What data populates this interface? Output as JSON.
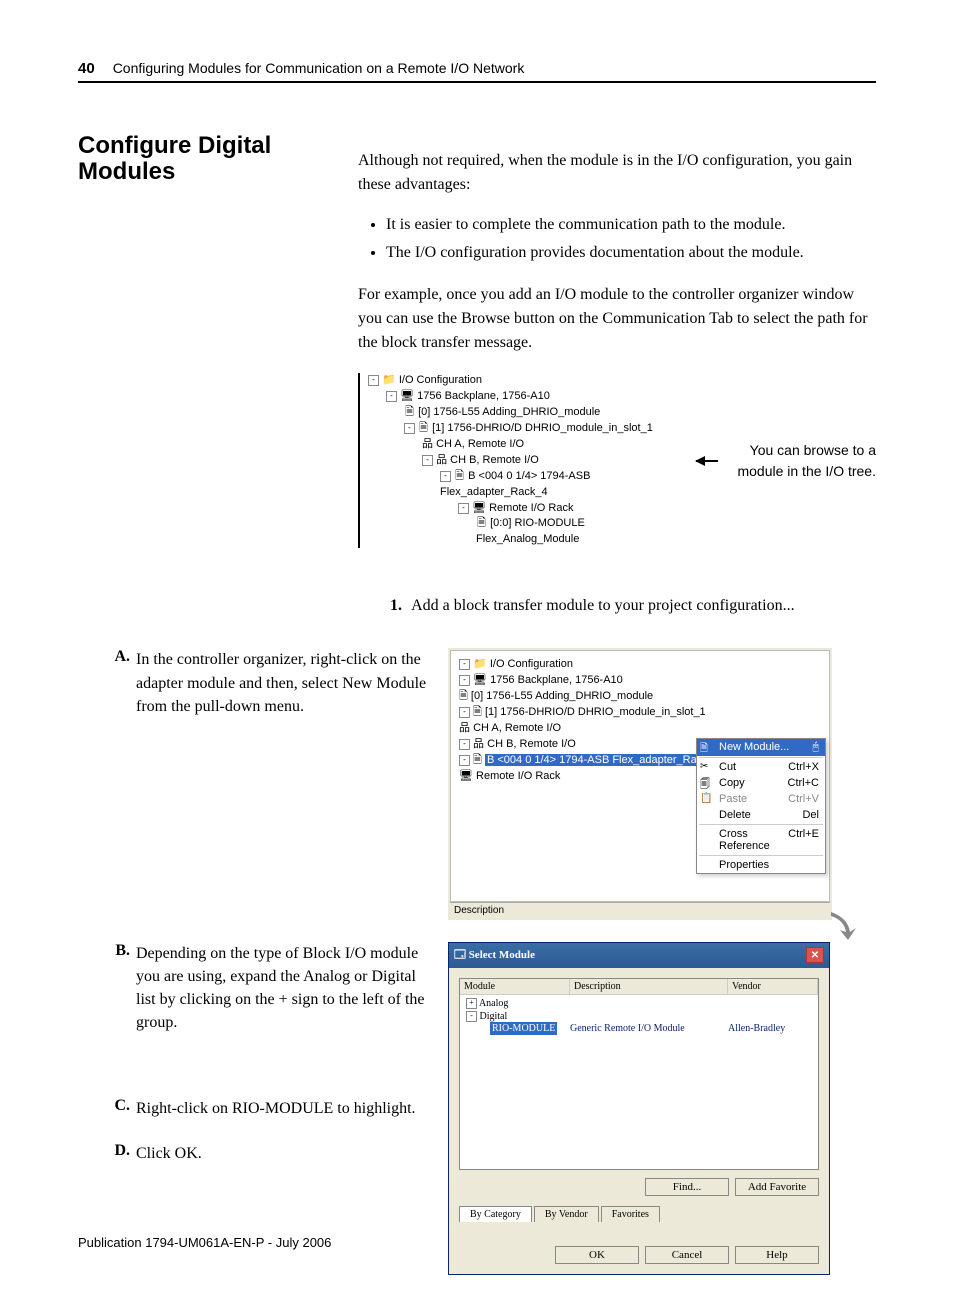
{
  "page": {
    "number": "40",
    "header": "Configuring Modules for Communication on a Remote I/O Network",
    "footer": "Publication 1794-UM061A-EN-P - July 2006"
  },
  "section": {
    "heading": "Configure Digital Modules",
    "intro": "Although not required, when the module is in the I/O configuration, you gain these advantages:",
    "bullets": [
      "It is easier to complete the communication path to the module.",
      "The I/O configuration provides documentation about the module."
    ],
    "example": "For example, once you add an I/O module to the controller organizer window you can use the Browse button on the Communication Tab to select the path for the block transfer message."
  },
  "tree1": {
    "l0": "I/O Configuration",
    "l1": "1756 Backplane, 1756-A10",
    "l2a": "[0] 1756-L55 Adding_DHRIO_module",
    "l2b": "[1] 1756-DHRIO/D DHRIO_module_in_slot_1",
    "l3a": "CH A, Remote I/O",
    "l3b": "CH B, Remote I/O",
    "l4": "B <004 0 1/4> 1794-ASB Flex_adapter_Rack_4",
    "l5": "Remote I/O Rack",
    "l6": "[0:0] RIO-MODULE Flex_Analog_Module"
  },
  "callout": "You can browse to a module in the I/O tree.",
  "step1": {
    "num": "1.",
    "text": "Add a block transfer module to your project configuration..."
  },
  "substeps": {
    "A": {
      "letter": "A.",
      "text": "In the controller organizer, right-click on the adapter module and then, select New Module from the pull-down menu."
    },
    "B": {
      "letter": "B.",
      "text": "Depending on the type of Block I/O module you are using, expand the Analog or Digital list by clicking on the + sign to the left of the group."
    },
    "C": {
      "letter": "C.",
      "text": "Right-click on RIO-MODULE to highlight."
    },
    "D": {
      "letter": "D.",
      "text": "Click OK."
    }
  },
  "ssA": {
    "tree": {
      "l0": "I/O Configuration",
      "l1": "1756 Backplane, 1756-A10",
      "l2a": "[0] 1756-L55 Adding_DHRIO_module",
      "l2b": "[1] 1756-DHRIO/D DHRIO_module_in_slot_1",
      "l3a": "CH A, Remote I/O",
      "l3b": "CH B, Remote I/O",
      "l4": "B <004 0 1/4> 1794-ASB Flex_adapter_Rack_4",
      "l5": "Remote I/O Rack"
    },
    "menu": {
      "new": "New Module...",
      "cut": "Cut",
      "cut_k": "Ctrl+X",
      "copy": "Copy",
      "copy_k": "Ctrl+C",
      "paste": "Paste",
      "paste_k": "Ctrl+V",
      "delete": "Delete",
      "delete_k": "Del",
      "xref": "Cross Reference",
      "xref_k": "Ctrl+E",
      "props": "Properties"
    },
    "desc": "Description"
  },
  "ssB": {
    "title": "Select Module",
    "hModule": "Module",
    "hDesc": "Description",
    "hVendor": "Vendor",
    "rAnalog": "Analog",
    "rDigital": "Digital",
    "rRio": "RIO-MODULE",
    "rRioDesc": "Generic Remote I/O Module",
    "rRioVendor": "Allen-Bradley",
    "find": "Find...",
    "addFav": "Add Favorite",
    "tabCat": "By Category",
    "tabVendor": "By Vendor",
    "tabFav": "Favorites",
    "ok": "OK",
    "cancel": "Cancel",
    "help": "Help"
  }
}
